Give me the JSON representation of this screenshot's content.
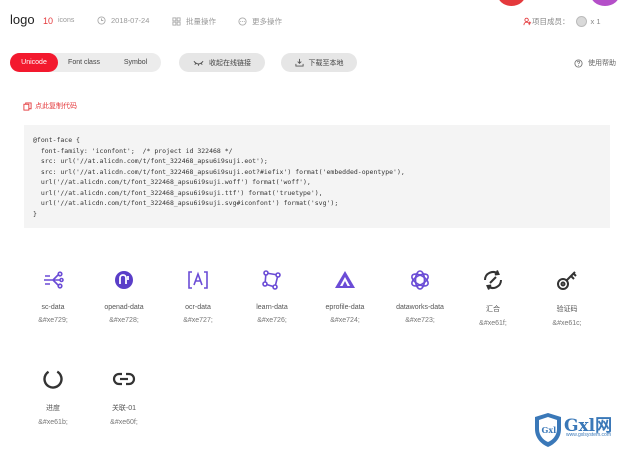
{
  "header": {
    "title": "logo",
    "icon_count": "10",
    "icon_count_label": "icons",
    "date": "2018-07-24",
    "batch_label": "批量操作",
    "more_label": "更多操作",
    "members_label": "项目成员：",
    "members_count": "x 1"
  },
  "tabs": [
    "Unicode",
    "Font class",
    "Symbol"
  ],
  "actions": {
    "collapse_label": "收起在线链接",
    "download_label": "下载至本地",
    "help_label": "使用帮助"
  },
  "copy_label": "点此复制代码",
  "code_text": "@font-face {\n  font-family: 'iconfont';  /* project id 322468 */\n  src: url('//at.alicdn.com/t/font_322468_apsu6i9suji.eot');\n  src: url('//at.alicdn.com/t/font_322468_apsu6i9suji.eot?#iefix') format('embedded-opentype'),\n  url('//at.alicdn.com/t/font_322468_apsu6i9suji.woff') format('woff'),\n  url('//at.alicdn.com/t/font_322468_apsu6i9suji.ttf') format('truetype'),\n  url('//at.alicdn.com/t/font_322468_apsu6i9suji.svg#iconfont') format('svg');\n}",
  "icons": [
    {
      "name": "sc-data",
      "code": "&#xe729;",
      "icon": "network-nodes-icon"
    },
    {
      "name": "openad-data",
      "code": "&#xe728;",
      "icon": "openad-icon"
    },
    {
      "name": "ocr-data",
      "code": "&#xe727;",
      "icon": "ocr-bracket-a-icon"
    },
    {
      "name": "learn-data",
      "code": "&#xe726;",
      "icon": "learn-nodes-icon"
    },
    {
      "name": "eprofile-data",
      "code": "&#xe724;",
      "icon": "triangle-stack-icon"
    },
    {
      "name": "dataworks-data",
      "code": "&#xe723;",
      "icon": "interlocking-rings-icon"
    },
    {
      "name": "汇合",
      "code": "&#xe61f;",
      "icon": "merge-icon"
    },
    {
      "name": "验证码",
      "code": "&#xe61c;",
      "icon": "key-icon"
    },
    {
      "name": "进度",
      "code": "&#xe61b;",
      "icon": "progress-ring-icon"
    },
    {
      "name": "关联-01",
      "code": "&#xe60f;",
      "icon": "link-icon"
    }
  ],
  "colors": {
    "accent": "#f3192e",
    "icon_purple": "#6b4cd6",
    "icon_dark": "#333333"
  },
  "watermark": {
    "text": "Gxl网",
    "sub": "www.gxlsystem.com"
  }
}
